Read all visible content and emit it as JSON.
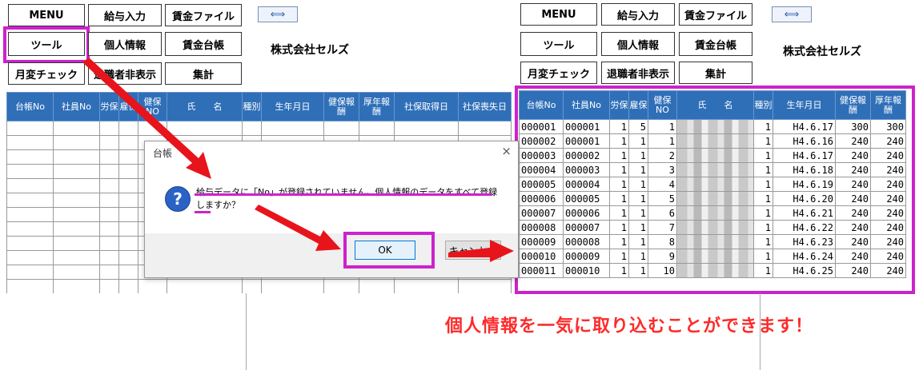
{
  "left": {
    "buttons": {
      "menu": "MENU",
      "payroll_input": "給与入力",
      "wage_file": "賃金ファイル",
      "tools": "ツール",
      "personal_info": "個人情報",
      "wage_ledger": "賃金台帳",
      "monthly_check": "月変チェック",
      "hide_retired": "退職者非表示",
      "totals": "集計"
    },
    "company": "株式会社セルズ",
    "columns": [
      "台帳No",
      "社員No",
      "労保",
      "雇保",
      "健保NO",
      "氏　　名",
      "種別",
      "生年月日",
      "健保報酬",
      "厚年報酬",
      "社保取得日",
      "社保喪失日"
    ]
  },
  "dialog": {
    "title": "台帳",
    "close": "×",
    "icon": "?",
    "message_line1": "給与データに「No」が登録されていません。個人情報のデータをすべて登録しますか？",
    "ok": "OK",
    "cancel": "キャンセル"
  },
  "right": {
    "buttons": {
      "menu": "MENU",
      "payroll_input": "給与入力",
      "wage_file": "賃金ファイル",
      "tools": "ツール",
      "personal_info": "個人情報",
      "wage_ledger": "賃金台帳",
      "monthly_check": "月変チェック",
      "hide_retired": "退職者非表示",
      "totals": "集計"
    },
    "company": "株式会社セルズ",
    "columns": [
      "台帳No",
      "社員No",
      "労保",
      "雇保",
      "健保NO",
      "氏　　名",
      "種別",
      "生年月日",
      "健保報酬",
      "厚年報酬"
    ],
    "rows": [
      {
        "ledger": "000001",
        "emp": "000001",
        "rou": "1",
        "koyo": "5",
        "ken": "1",
        "kind": "1",
        "dob": "H4.6.17",
        "kenpo": "300",
        "kounen": "300"
      },
      {
        "ledger": "000002",
        "emp": "000001",
        "rou": "1",
        "koyo": "1",
        "ken": "1",
        "kind": "1",
        "dob": "H4.6.16",
        "kenpo": "240",
        "kounen": "240"
      },
      {
        "ledger": "000003",
        "emp": "000002",
        "rou": "1",
        "koyo": "1",
        "ken": "2",
        "kind": "1",
        "dob": "H4.6.17",
        "kenpo": "240",
        "kounen": "240"
      },
      {
        "ledger": "000004",
        "emp": "000003",
        "rou": "1",
        "koyo": "1",
        "ken": "3",
        "kind": "1",
        "dob": "H4.6.18",
        "kenpo": "240",
        "kounen": "240"
      },
      {
        "ledger": "000005",
        "emp": "000004",
        "rou": "1",
        "koyo": "1",
        "ken": "4",
        "kind": "1",
        "dob": "H4.6.19",
        "kenpo": "240",
        "kounen": "240"
      },
      {
        "ledger": "000006",
        "emp": "000005",
        "rou": "1",
        "koyo": "1",
        "ken": "5",
        "kind": "1",
        "dob": "H4.6.20",
        "kenpo": "240",
        "kounen": "240"
      },
      {
        "ledger": "000007",
        "emp": "000006",
        "rou": "1",
        "koyo": "1",
        "ken": "6",
        "kind": "1",
        "dob": "H4.6.21",
        "kenpo": "240",
        "kounen": "240"
      },
      {
        "ledger": "000008",
        "emp": "000007",
        "rou": "1",
        "koyo": "1",
        "ken": "7",
        "kind": "1",
        "dob": "H4.6.22",
        "kenpo": "240",
        "kounen": "240"
      },
      {
        "ledger": "000009",
        "emp": "000008",
        "rou": "1",
        "koyo": "1",
        "ken": "8",
        "kind": "1",
        "dob": "H4.6.23",
        "kenpo": "240",
        "kounen": "240"
      },
      {
        "ledger": "000010",
        "emp": "000009",
        "rou": "1",
        "koyo": "1",
        "ken": "9",
        "kind": "1",
        "dob": "H4.6.24",
        "kenpo": "240",
        "kounen": "240"
      },
      {
        "ledger": "000011",
        "emp": "000010",
        "rou": "1",
        "koyo": "1",
        "ken": "10",
        "kind": "1",
        "dob": "H4.6.25",
        "kenpo": "240",
        "kounen": "240"
      }
    ]
  },
  "callout": "個人情報を一気に取り込むことができます！",
  "colors": {
    "highlight": "#cc22cc",
    "header": "#2f6fb8",
    "arrow": "#e8141b",
    "callout": "#ff2a2a"
  }
}
